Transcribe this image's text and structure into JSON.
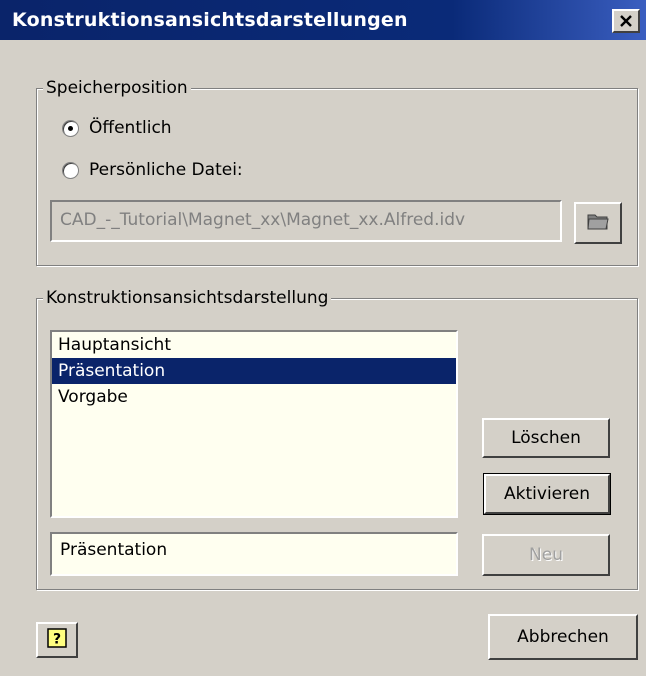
{
  "window": {
    "title": "Konstruktionsansichtsdarstellungen",
    "close_icon": "close-icon"
  },
  "storage": {
    "group_label": "Speicherposition",
    "option_public": {
      "label": "Öffentlich",
      "selected": true
    },
    "option_personal": {
      "label": "Persönliche Datei:",
      "selected": false
    },
    "path_value": "CAD_-_Tutorial\\Magnet_xx\\Magnet_xx.Alfred.idv",
    "browse_icon": "folder-icon"
  },
  "views": {
    "group_label": "Konstruktionsansichtsdarstellung",
    "items": [
      {
        "label": "Hauptansicht",
        "selected": false
      },
      {
        "label": "Präsentation",
        "selected": true
      },
      {
        "label": "Vorgabe",
        "selected": false
      }
    ],
    "name_value": "Präsentation",
    "delete_label": "Löschen",
    "activate_label": "Aktivieren",
    "new_label": "Neu"
  },
  "footer": {
    "help_icon": "help-icon",
    "cancel_label": "Abbrechen"
  },
  "colors": {
    "titlebar": "#0a246a",
    "dialog": "#d4d0c8",
    "selection": "#0a246a",
    "field": "#fffff0"
  }
}
